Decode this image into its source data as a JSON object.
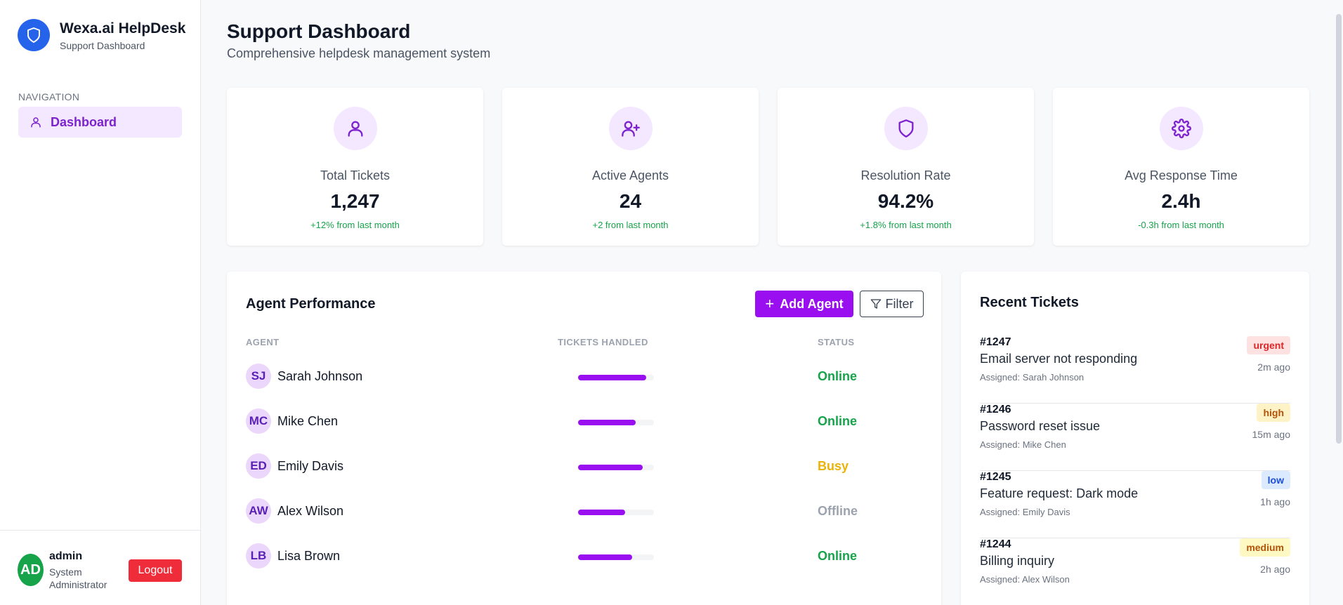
{
  "brand": {
    "title": "Wexa.ai HelpDesk",
    "subtitle": "Support Dashboard"
  },
  "sidebar": {
    "nav_label": "NAVIGATION",
    "items": [
      {
        "label": "Dashboard",
        "icon": "user-icon",
        "active": true
      }
    ]
  },
  "user": {
    "initials": "AD",
    "name": "admin",
    "role": "System Administrator",
    "logout_label": "Logout"
  },
  "header": {
    "title": "Support Dashboard",
    "subtitle": "Comprehensive helpdesk management system"
  },
  "stats": [
    {
      "label": "Total Tickets",
      "value": "1,247",
      "change": "+12% from last month",
      "icon": "user-icon"
    },
    {
      "label": "Active Agents",
      "value": "24",
      "change": "+2 from last month",
      "icon": "user-plus-icon"
    },
    {
      "label": "Resolution Rate",
      "value": "94.2%",
      "change": "+1.8% from last month",
      "icon": "shield-icon"
    },
    {
      "label": "Avg Response Time",
      "value": "2.4h",
      "change": "-0.3h from last month",
      "icon": "gear-icon"
    }
  ],
  "agent_performance": {
    "title": "Agent Performance",
    "add_label": "Add Agent",
    "filter_label": "Filter",
    "columns": [
      "AGENT",
      "TICKETS HANDLED",
      "STATUS"
    ],
    "agents": [
      {
        "initials": "SJ",
        "name": "Sarah Johnson",
        "tickets_fraction": 0.9,
        "status": "Online"
      },
      {
        "initials": "MC",
        "name": "Mike Chen",
        "tickets_fraction": 0.76,
        "status": "Online"
      },
      {
        "initials": "ED",
        "name": "Emily Davis",
        "tickets_fraction": 0.85,
        "status": "Busy"
      },
      {
        "initials": "AW",
        "name": "Alex Wilson",
        "tickets_fraction": 0.62,
        "status": "Offline"
      },
      {
        "initials": "LB",
        "name": "Lisa Brown",
        "tickets_fraction": 0.71,
        "status": "Online"
      }
    ]
  },
  "recent_tickets": {
    "title": "Recent Tickets",
    "tickets": [
      {
        "id": "#1247",
        "title": "Email server not responding",
        "assigned": "Assigned: Sarah Johnson",
        "priority": "urgent",
        "time": "2m ago"
      },
      {
        "id": "#1246",
        "title": "Password reset issue",
        "assigned": "Assigned: Mike Chen",
        "priority": "high",
        "time": "15m ago"
      },
      {
        "id": "#1245",
        "title": "Feature request: Dark mode",
        "assigned": "Assigned: Emily Davis",
        "priority": "low",
        "time": "1h ago"
      },
      {
        "id": "#1244",
        "title": "Billing inquiry",
        "assigned": "Assigned: Alex Wilson",
        "priority": "medium",
        "time": "2h ago"
      }
    ]
  },
  "colors": {
    "accent": "#9a0ff0",
    "brand": "#2563eb",
    "status_online": "#16a34a",
    "status_busy": "#eab308",
    "status_offline": "#9ca3af",
    "priority_urgent": "#dc2626",
    "priority_high": "#b45309",
    "priority_low": "#1d4ed8",
    "priority_medium": "#b45309"
  }
}
